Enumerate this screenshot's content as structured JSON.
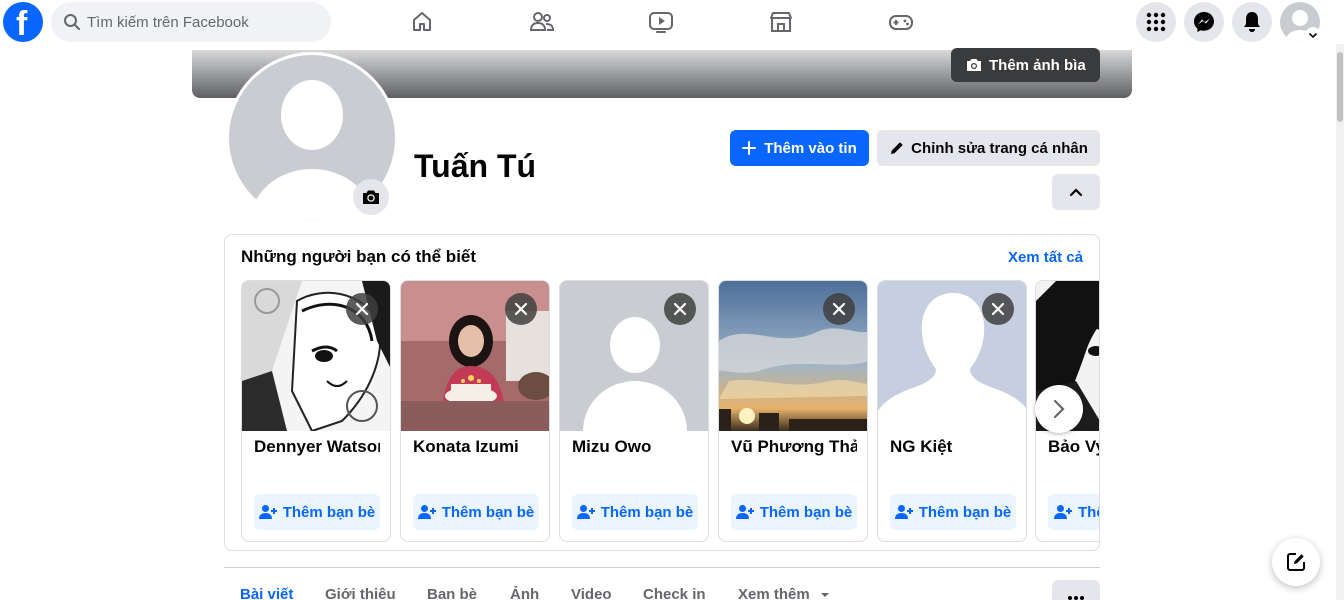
{
  "topnav": {
    "search_placeholder": "Tìm kiếm trên Facebook",
    "logo_letter": "f",
    "tabs": [
      "home-icon",
      "friends-icon",
      "watch-icon",
      "marketplace-icon",
      "gaming-icon"
    ],
    "right_buttons": [
      "menu-icon",
      "messenger-icon",
      "notifications-icon",
      "account-icon"
    ]
  },
  "cover": {
    "edit_cover_label": "Thêm ảnh bìa"
  },
  "profile": {
    "name": "Tuấn Tú",
    "add_story_label": "Thêm vào tin",
    "edit_profile_label": "Chỉnh sửa trang cá nhân"
  },
  "pymk": {
    "title": "Những người bạn có thể biết",
    "see_all_label": "Xem tất cả",
    "add_friend_label": "Thêm bạn bè",
    "people": [
      {
        "name": "Dennyer Watson"
      },
      {
        "name": "Konata Izumi"
      },
      {
        "name": "Mizu Owo"
      },
      {
        "name": "Vũ Phương Thảo"
      },
      {
        "name": "NG Kiệt"
      },
      {
        "name": "Bảo Vy"
      }
    ]
  },
  "profile_tabs": {
    "items": [
      "Bài viết",
      "Giới thiệu",
      "Bạn bè",
      "Ảnh",
      "Video",
      "Check in",
      "Xem thêm"
    ],
    "active": "Bài viết"
  },
  "colors": {
    "accent": "#0866ff",
    "accent_bg": "#ebf5ff",
    "button_gray": "#e4e6eb"
  }
}
